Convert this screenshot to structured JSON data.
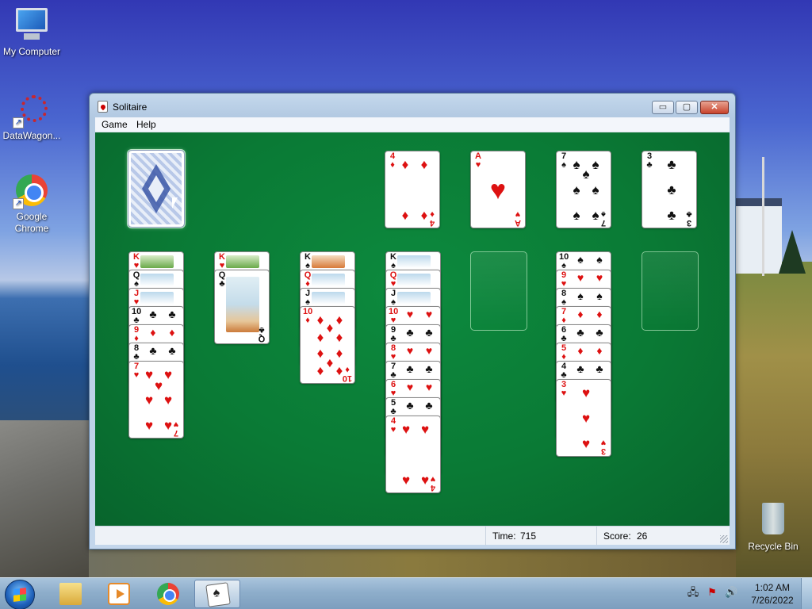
{
  "desktop": {
    "icons": [
      {
        "label": "My Computer",
        "icon": "my-computer-icon"
      },
      {
        "label": "DataWagon...",
        "icon": "datawagon-icon"
      },
      {
        "label": "Google Chrome",
        "icon": "chrome-icon"
      },
      {
        "label": "Recycle Bin",
        "icon": "recycle-bin-icon"
      }
    ]
  },
  "window": {
    "title": "Solitaire",
    "buttons": {
      "minimize": "▭",
      "maximize": "▢",
      "close": "✕"
    },
    "menu": [
      "Game",
      "Help"
    ]
  },
  "game": {
    "stock": {
      "face_down": true
    },
    "foundations": [
      {
        "rank": "4",
        "suit": "♦",
        "color": "red"
      },
      {
        "rank": "A",
        "suit": "♥",
        "color": "red"
      },
      {
        "rank": "7",
        "suit": "♠",
        "color": "black"
      },
      {
        "rank": "3",
        "suit": "♣",
        "color": "black"
      }
    ],
    "tableau": [
      [
        {
          "rank": "K",
          "suit": "♥"
        },
        {
          "rank": "Q",
          "suit": "♠"
        },
        {
          "rank": "J",
          "suit": "♥"
        },
        {
          "rank": "10",
          "suit": "♣"
        },
        {
          "rank": "9",
          "suit": "♦"
        },
        {
          "rank": "8",
          "suit": "♣"
        },
        {
          "rank": "7",
          "suit": "♥"
        }
      ],
      [
        {
          "rank": "K",
          "suit": "♥"
        },
        {
          "rank": "Q",
          "suit": "♣"
        }
      ],
      [
        {
          "rank": "K",
          "suit": "♠"
        },
        {
          "rank": "Q",
          "suit": "♦"
        },
        {
          "rank": "J",
          "suit": "♠"
        },
        {
          "rank": "10",
          "suit": "♦"
        }
      ],
      [
        {
          "rank": "K",
          "suit": "♠"
        },
        {
          "rank": "Q",
          "suit": "♥"
        },
        {
          "rank": "J",
          "suit": "♠"
        },
        {
          "rank": "10",
          "suit": "♥"
        },
        {
          "rank": "9",
          "suit": "♣"
        },
        {
          "rank": "8",
          "suit": "♥"
        },
        {
          "rank": "7",
          "suit": "♣"
        },
        {
          "rank": "6",
          "suit": "♥"
        },
        {
          "rank": "5",
          "suit": "♣"
        },
        {
          "rank": "4",
          "suit": "♥"
        }
      ],
      [],
      [
        {
          "rank": "10",
          "suit": "♠"
        },
        {
          "rank": "9",
          "suit": "♥"
        },
        {
          "rank": "8",
          "suit": "♠"
        },
        {
          "rank": "7",
          "suit": "♦"
        },
        {
          "rank": "6",
          "suit": "♣"
        },
        {
          "rank": "5",
          "suit": "♦"
        },
        {
          "rank": "4",
          "suit": "♣"
        },
        {
          "rank": "3",
          "suit": "♥"
        }
      ],
      []
    ]
  },
  "status": {
    "time_label": "Time:",
    "time_value": "715",
    "score_label": "Score:",
    "score_value": "26"
  },
  "taskbar": {
    "items": [
      {
        "icon": "file-explorer-icon"
      },
      {
        "icon": "media-player-icon"
      },
      {
        "icon": "chrome-icon"
      },
      {
        "icon": "solitaire-icon",
        "active": true
      }
    ],
    "tray": [
      "network-icon",
      "action-center-icon",
      "volume-icon"
    ],
    "clock": {
      "time": "1:02 AM",
      "date": "7/26/2022"
    }
  }
}
